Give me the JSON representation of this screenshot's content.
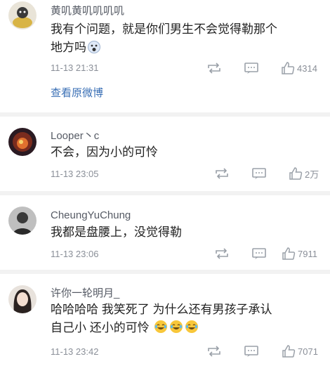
{
  "comments": [
    {
      "username": "黄叽黄叽叽叽叽",
      "text_line1": "我有个问题，就是你们男生不会觉得勒那个",
      "text_line2": "地方吗",
      "time": "11-13 21:31",
      "likes": "4314",
      "link": "查看原微博"
    },
    {
      "username": "Looper丶c",
      "text_line1": "不会，因为小的可怜",
      "time": "11-13 23:05",
      "likes": "2万"
    },
    {
      "username": "CheungYuChung",
      "text_line1": "我都是盘腰上，没觉得勒",
      "time": "11-13 23:06",
      "likes": "7911"
    },
    {
      "username": "许你一轮明月_",
      "text_line1": "哈哈哈哈 我笑死了 为什么还有男孩子承认",
      "text_line2": "自己小 还小的可怜",
      "time": "11-13 23:42",
      "likes": "7071"
    }
  ],
  "icons": {
    "repost": "repost-icon",
    "comment": "comment-icon",
    "like": "thumbs-up-icon",
    "emoji_tears": "laughing-tears-emoji",
    "emoji_scared": "scared-face-emoji"
  },
  "colors": {
    "link": "#3a6fb5",
    "meta": "#8a8f98",
    "username": "#555a64",
    "background": "#f2f2f2"
  }
}
